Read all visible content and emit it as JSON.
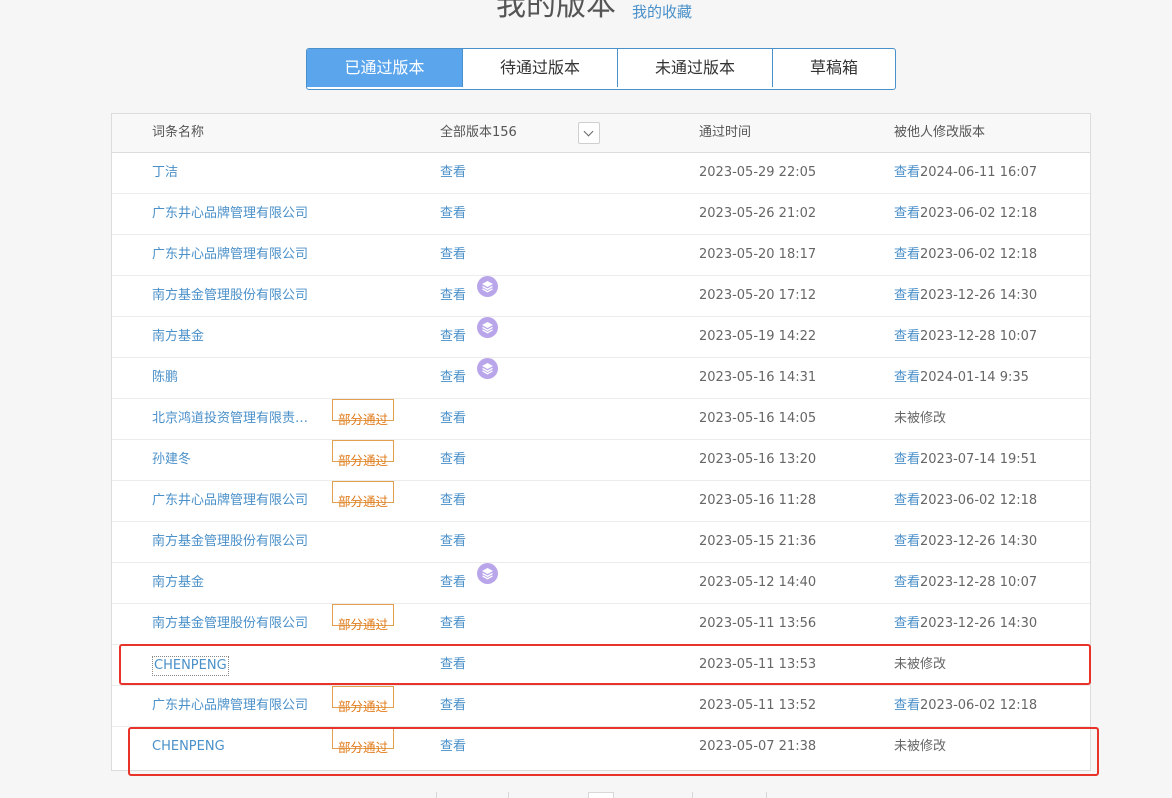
{
  "header": {
    "title": "我的版本",
    "favorites_link": "我的收藏"
  },
  "tabs": [
    {
      "label": "已通过版本",
      "active": true
    },
    {
      "label": "待通过版本",
      "active": false
    },
    {
      "label": "未通过版本",
      "active": false
    },
    {
      "label": "草稿箱",
      "active": false
    }
  ],
  "table": {
    "columns": {
      "name": "词条名称",
      "all_versions": "全部版本156",
      "time": "通过时间",
      "modified_by_others": "被他人修改版本"
    },
    "rows": [
      {
        "name": "丁洁",
        "badge": "",
        "view": "查看",
        "layers_icon": false,
        "time": "2023-05-29 22:05",
        "other_link": "查看",
        "other_text": "2024-06-11 16:07"
      },
      {
        "name": "广东井心品牌管理有限公司",
        "badge": "",
        "view": "查看",
        "layers_icon": false,
        "time": "2023-05-26 21:02",
        "other_link": "查看",
        "other_text": "2023-06-02 12:18"
      },
      {
        "name": "广东井心品牌管理有限公司",
        "badge": "",
        "view": "查看",
        "layers_icon": false,
        "time": "2023-05-20 18:17",
        "other_link": "查看",
        "other_text": "2023-06-02 12:18"
      },
      {
        "name": "南方基金管理股份有限公司",
        "badge": "",
        "view": "查看",
        "layers_icon": true,
        "time": "2023-05-20 17:12",
        "other_link": "查看",
        "other_text": "2023-12-26 14:30"
      },
      {
        "name": "南方基金",
        "badge": "",
        "view": "查看",
        "layers_icon": true,
        "time": "2023-05-19 14:22",
        "other_link": "查看",
        "other_text": "2023-12-28 10:07"
      },
      {
        "name": "陈鹏",
        "badge": "",
        "view": "查看",
        "layers_icon": true,
        "time": "2023-05-16 14:31",
        "other_link": "查看",
        "other_text": "2024-01-14 9:35"
      },
      {
        "name": "北京鸿道投资管理有限责…",
        "badge": "部分通过",
        "view": "查看",
        "layers_icon": false,
        "time": "2023-05-16 14:05",
        "other_link": "",
        "other_text": "未被修改"
      },
      {
        "name": "孙建冬",
        "badge": "部分通过",
        "view": "查看",
        "layers_icon": false,
        "time": "2023-05-16 13:20",
        "other_link": "查看",
        "other_text": "2023-07-14 19:51"
      },
      {
        "name": "广东井心品牌管理有限公司",
        "badge": "部分通过",
        "view": "查看",
        "layers_icon": false,
        "time": "2023-05-16 11:28",
        "other_link": "查看",
        "other_text": "2023-06-02 12:18"
      },
      {
        "name": "南方基金管理股份有限公司",
        "badge": "",
        "view": "查看",
        "layers_icon": false,
        "time": "2023-05-15 21:36",
        "other_link": "查看",
        "other_text": "2023-12-26 14:30"
      },
      {
        "name": "南方基金",
        "badge": "",
        "view": "查看",
        "layers_icon": true,
        "time": "2023-05-12 14:40",
        "other_link": "查看",
        "other_text": "2023-12-28 10:07"
      },
      {
        "name": "南方基金管理股份有限公司",
        "badge": "部分通过",
        "view": "查看",
        "layers_icon": false,
        "time": "2023-05-11 13:56",
        "other_link": "查看",
        "other_text": "2023-12-26 14:30"
      },
      {
        "name": "CHENPENG",
        "badge": "",
        "view": "查看",
        "layers_icon": false,
        "time": "2023-05-11 13:53",
        "other_link": "",
        "other_text": "未被修改",
        "outlined": true
      },
      {
        "name": "广东井心品牌管理有限公司",
        "badge": "部分通过",
        "view": "查看",
        "layers_icon": false,
        "time": "2023-05-11 13:52",
        "other_link": "查看",
        "other_text": "2023-06-02 12:18"
      },
      {
        "name": "CHENPENG",
        "badge": "部分通过",
        "view": "查看",
        "layers_icon": false,
        "time": "2023-05-07 21:38",
        "other_link": "",
        "other_text": "未被修改"
      }
    ]
  },
  "colors": {
    "link": "#4a90c9",
    "active_tab": "#5aa5ec",
    "badge": "#e07b1a",
    "layers_icon": "#b9a6ea",
    "annotation": "#e8332a"
  },
  "icons": {
    "dropdown": "chevron-down-icon",
    "layers": "layers-icon"
  }
}
